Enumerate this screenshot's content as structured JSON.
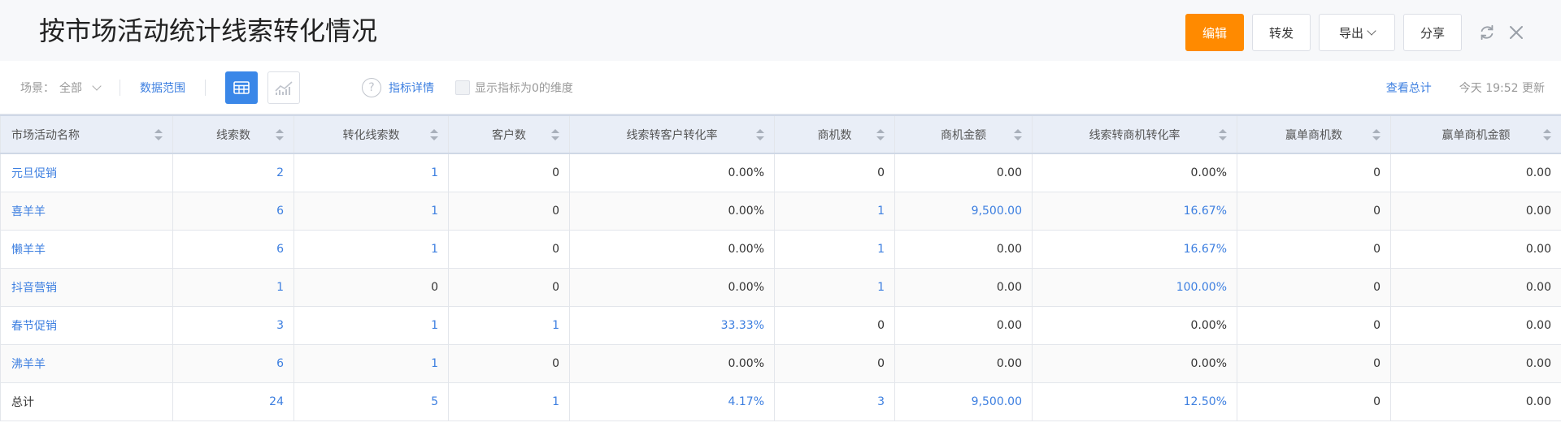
{
  "header": {
    "title": "按市场活动统计线索转化情况",
    "edit_label": "编辑",
    "forward_label": "转发",
    "export_label": "导出",
    "share_label": "分享"
  },
  "toolbar": {
    "scene_label": "场景：",
    "scene_value": "全部",
    "data_range_label": "数据范围",
    "metric_detail_label": "指标详情",
    "show_zero_label": "显示指标为0的维度",
    "help_glyph": "?",
    "view_total_label": "查看总计",
    "updated_text": "今天 19:52 更新"
  },
  "table": {
    "columns": [
      "市场活动名称",
      "线索数",
      "转化线索数",
      "客户数",
      "线索转客户转化率",
      "商机数",
      "商机金额",
      "线索转商机转化率",
      "赢单商机数",
      "赢单商机金额"
    ],
    "rows": [
      [
        "元旦促销",
        "2",
        "1",
        "0",
        "0.00%",
        "0",
        "0.00",
        "0.00%",
        "0",
        "0.00"
      ],
      [
        "喜羊羊",
        "6",
        "1",
        "0",
        "0.00%",
        "1",
        "9,500.00",
        "16.67%",
        "0",
        "0.00"
      ],
      [
        "懒羊羊",
        "6",
        "1",
        "0",
        "0.00%",
        "1",
        "0.00",
        "16.67%",
        "0",
        "0.00"
      ],
      [
        "抖音营销",
        "1",
        "0",
        "0",
        "0.00%",
        "1",
        "0.00",
        "100.00%",
        "0",
        "0.00"
      ],
      [
        "春节促销",
        "3",
        "1",
        "1",
        "33.33%",
        "0",
        "0.00",
        "0.00%",
        "0",
        "0.00"
      ],
      [
        "沸羊羊",
        "6",
        "1",
        "0",
        "0.00%",
        "0",
        "0.00",
        "0.00%",
        "0",
        "0.00"
      ],
      [
        "总计",
        "24",
        "5",
        "1",
        "4.17%",
        "3",
        "9,500.00",
        "12.50%",
        "0",
        "0.00"
      ]
    ],
    "links": [
      [
        1,
        1,
        1,
        0,
        0,
        0,
        0,
        0,
        0,
        0
      ],
      [
        1,
        1,
        1,
        0,
        0,
        1,
        1,
        1,
        0,
        0
      ],
      [
        1,
        1,
        1,
        0,
        0,
        1,
        0,
        1,
        0,
        0
      ],
      [
        1,
        1,
        0,
        0,
        0,
        1,
        0,
        1,
        0,
        0
      ],
      [
        1,
        1,
        1,
        1,
        1,
        0,
        0,
        0,
        0,
        0
      ],
      [
        1,
        1,
        1,
        0,
        0,
        0,
        0,
        0,
        0,
        0
      ],
      [
        0,
        1,
        1,
        1,
        1,
        1,
        1,
        1,
        0,
        0
      ]
    ]
  },
  "colors": {
    "primary_button": "#ff8a00",
    "link": "#3d7fe0",
    "table_view_active": "#3a87e8",
    "header_row_bg": "#e9eef7"
  },
  "icons": {
    "refresh": "refresh-icon",
    "close": "close-icon",
    "table_view": "table-view-icon",
    "chart_view": "chart-view-icon",
    "help": "help-icon",
    "sort": "sort-icon"
  }
}
